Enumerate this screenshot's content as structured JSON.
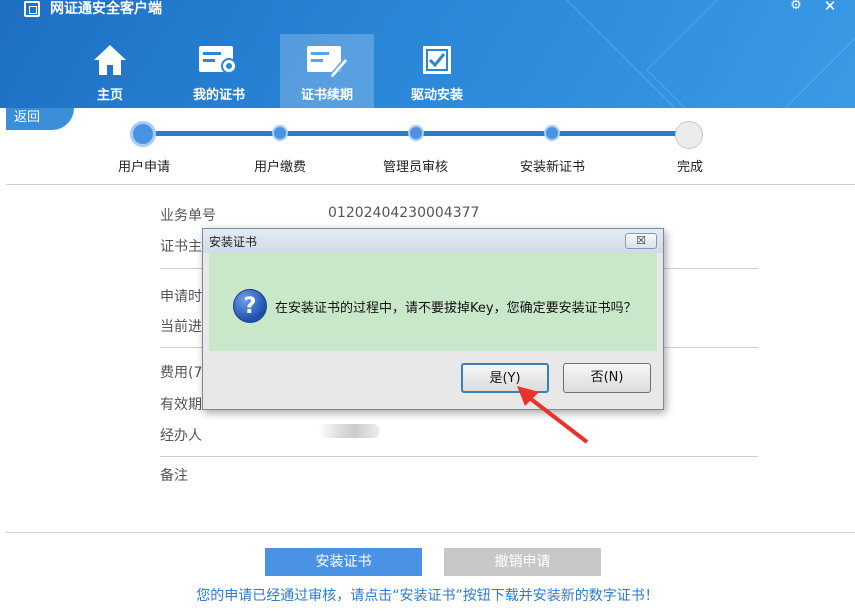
{
  "window": {
    "title": "网证通安全客户端",
    "gear": "⚙",
    "close": "✕"
  },
  "nav": [
    {
      "label": "主页",
      "icon": "home-icon"
    },
    {
      "label": "我的证书",
      "icon": "certificate-card-icon"
    },
    {
      "label": "证书续期",
      "icon": "certificate-renew-icon"
    },
    {
      "label": "驱动安装",
      "icon": "checkbox-icon"
    }
  ],
  "back_label": "返回",
  "steps": [
    "用户申请",
    "用户缴费",
    "管理员审核",
    "安装新证书",
    "完成"
  ],
  "steps_completed": 4,
  "info": {
    "order_label": "业务单号",
    "order_value": "01202404230004377",
    "subject_label": "证书主",
    "apply_time_label": "申请时",
    "progress_label": "当前进",
    "fee_label": "费用(7",
    "validity_label": "有效期",
    "handler_label": "经办人",
    "remark_label": "备注"
  },
  "buttons": {
    "install": "安装证书",
    "cancel": "撤销申请"
  },
  "notice": "您的申请已经通过审核，请点击“安装证书”按钮下载并安装新的数字证书！",
  "dialog": {
    "title": "安装证书",
    "close": "☒",
    "icon": "?",
    "message": "在安装证书的过程中，请不要拔掉Key，您确定要安装证书吗？",
    "yes": "是(Y)",
    "no": "否(N)"
  },
  "colors": {
    "header": "#2a86d8",
    "accent": "#2b7bd0",
    "dialog_body": "#c9e7c9",
    "arrow": "#e8322b"
  }
}
